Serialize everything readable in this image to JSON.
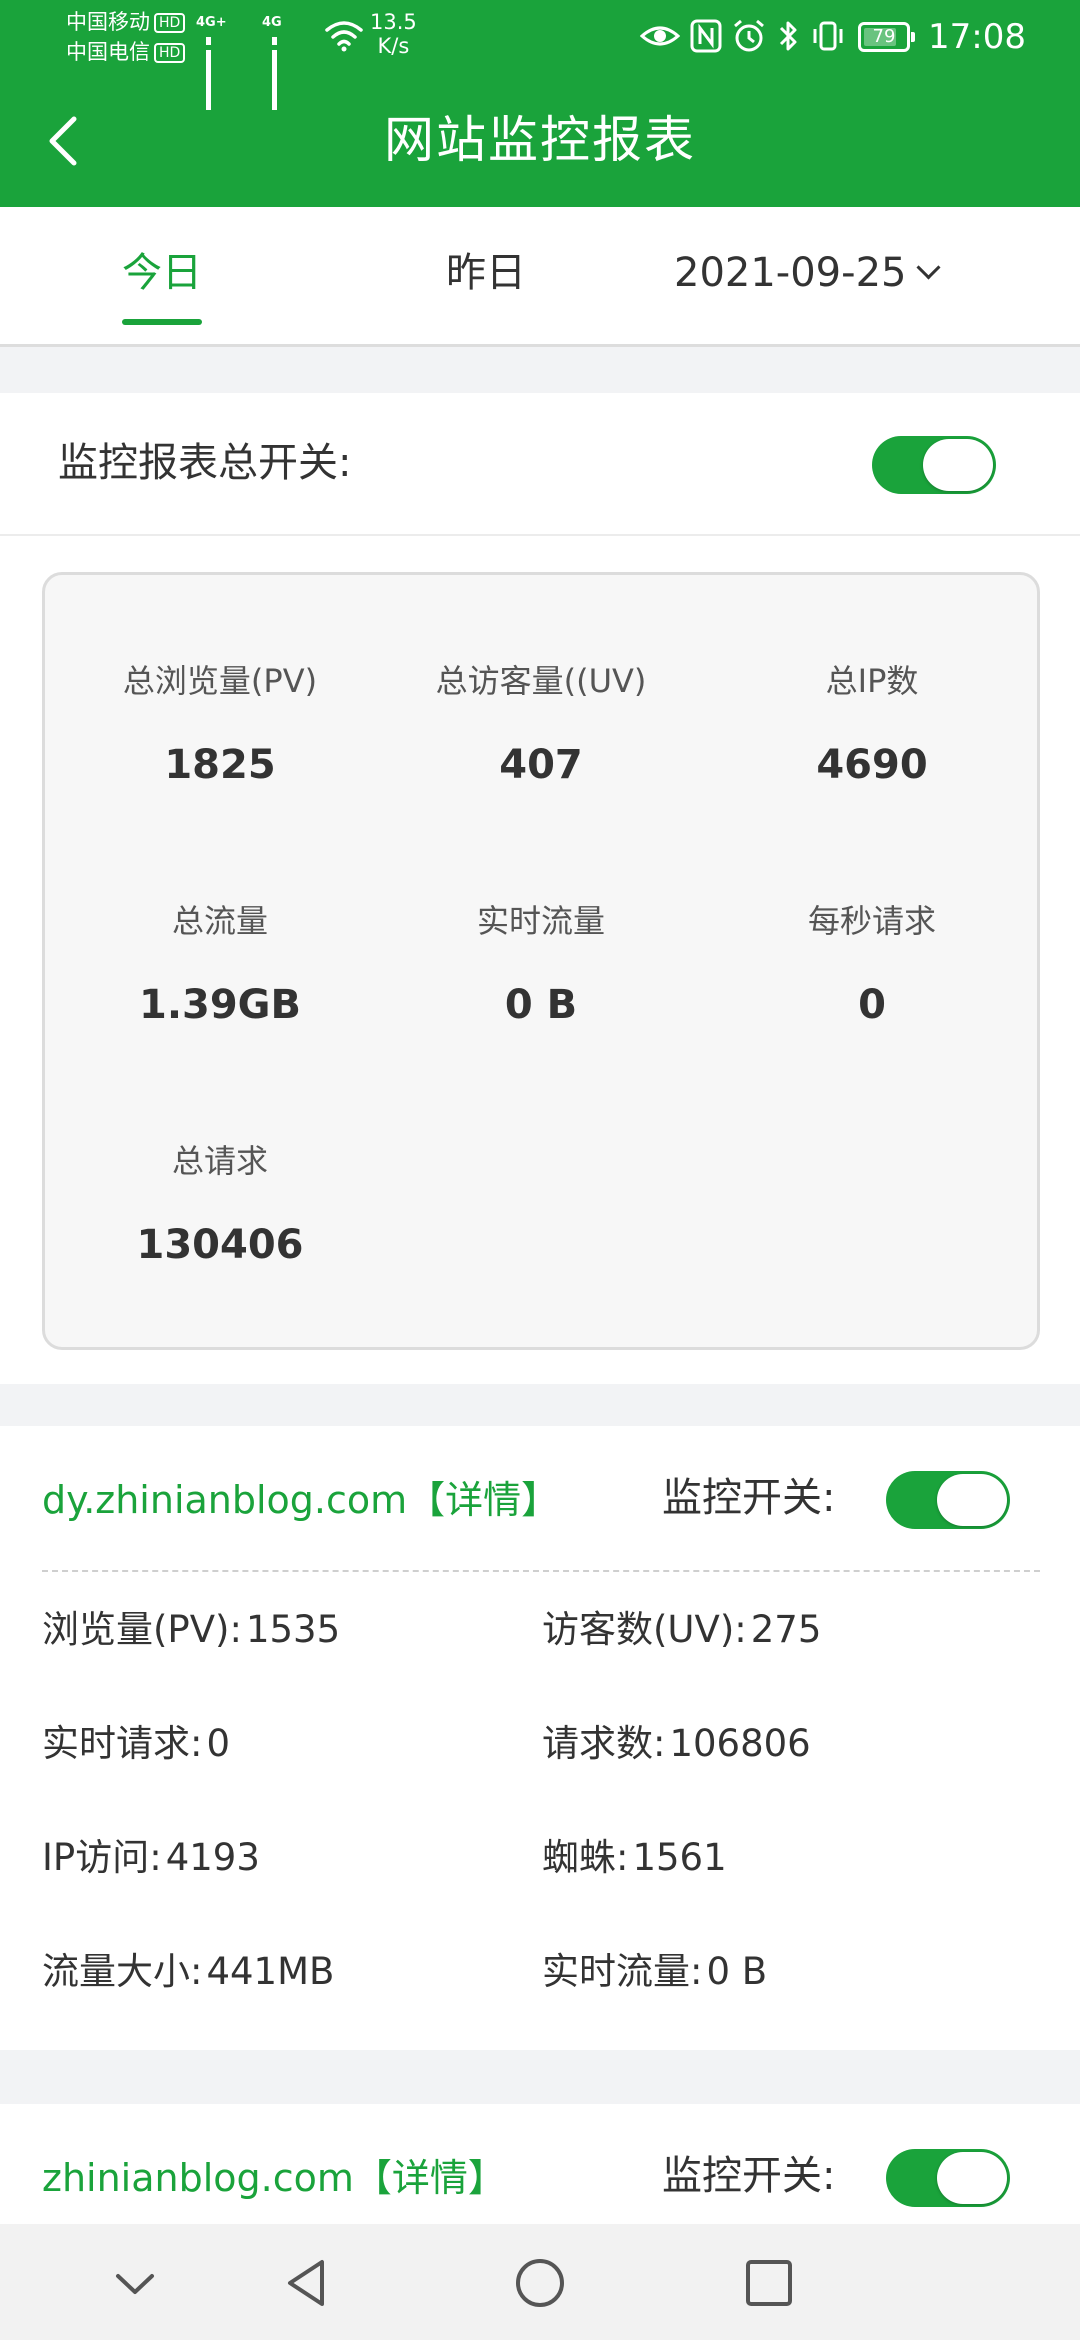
{
  "status_bar": {
    "carrier_1": "中国移动",
    "carrier_2": "中国电信",
    "hd": "HD",
    "network_type": "4G+",
    "network_type_2": "4G",
    "net_speed_value": "13.5",
    "net_speed_unit": "K/s",
    "battery": "79",
    "battery_level": 0.79,
    "time": "17:08"
  },
  "header": {
    "title": "网站监控报表"
  },
  "tabs": {
    "today": "今日",
    "yesterday": "昨日",
    "date": "2021-09-25"
  },
  "master_switch": {
    "label": "监控报表总开关:",
    "on": true
  },
  "summary": {
    "pv_label": "总浏览量(PV)",
    "pv_value": "1825",
    "uv_label": "总访客量((UV)",
    "uv_value": "407",
    "ip_label": "总IP数",
    "ip_value": "4690",
    "traffic_label": "总流量",
    "traffic_value": "1.39GB",
    "realtime_traffic_label": "实时流量",
    "realtime_traffic_value": "0 B",
    "rps_label": "每秒请求",
    "rps_value": "0",
    "requests_label": "总请求",
    "requests_value": "130406"
  },
  "sites": [
    {
      "domain": "dy.zhinianblog.com",
      "detail": "【详情】",
      "monitor_label": "监控开关:",
      "monitor_on": true,
      "pv_label": "浏览量(PV):",
      "pv_value": "1535",
      "uv_label": "访客数(UV):",
      "uv_value": "275",
      "rt_req_label": "实时请求:",
      "rt_req_value": "0",
      "req_label": "请求数:",
      "req_value": "106806",
      "ip_label": "IP访问:",
      "ip_value": "4193",
      "spider_label": "蜘蛛:",
      "spider_value": "1561",
      "traffic_label": "流量大小:",
      "traffic_value": "441MB",
      "rt_traffic_label": "实时流量:",
      "rt_traffic_value": "0 B"
    },
    {
      "domain": "zhinianblog.com",
      "detail": "【详情】",
      "monitor_label": "监控开关:",
      "monitor_on": true
    }
  ],
  "colors": {
    "primary": "#1aa33b",
    "page_bg": "#f2f3f5",
    "card_bg": "#f7f7f7"
  },
  "icons": {
    "back": "chevron-left-icon",
    "nav_collapse": "chevron-down-icon",
    "nav_back": "triangle-back-icon",
    "nav_home": "circle-home-icon",
    "nav_recents": "square-recents-icon"
  }
}
